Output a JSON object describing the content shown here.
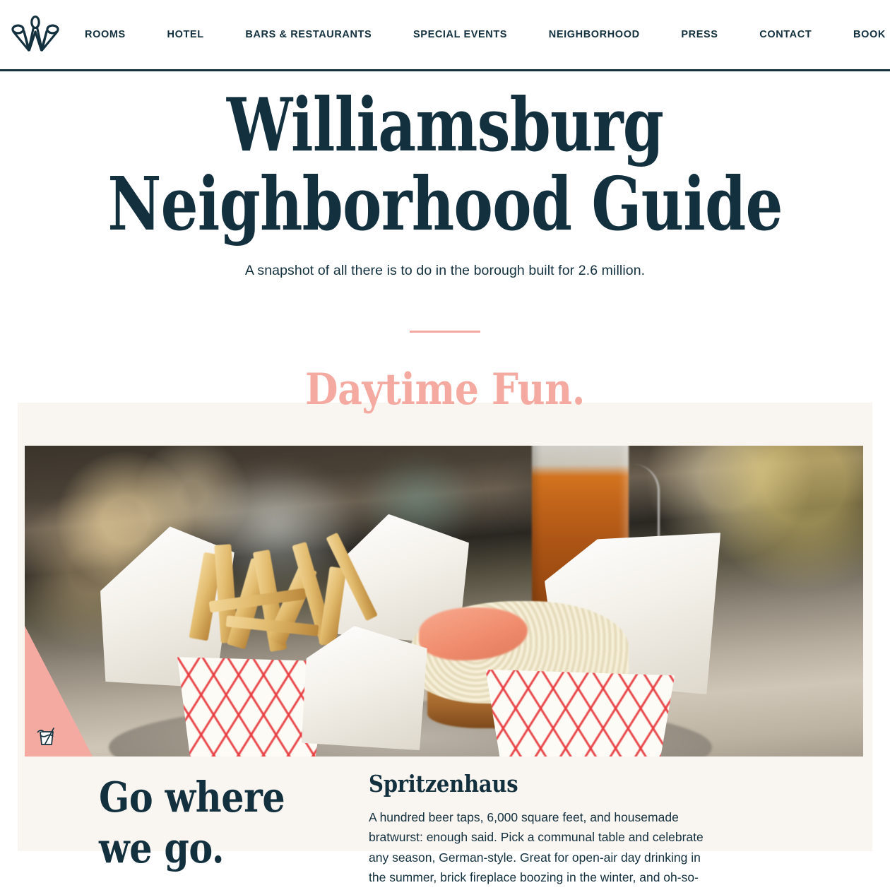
{
  "header": {
    "logo_name": "williamsburg-hotel-crown-monogram",
    "nav": [
      {
        "label": "ROOMS"
      },
      {
        "label": "HOTEL"
      },
      {
        "label": "BARS & RESTAURANTS"
      },
      {
        "label": "SPECIAL EVENTS"
      },
      {
        "label": "NEIGHBORHOOD"
      },
      {
        "label": "PRESS"
      },
      {
        "label": "CONTACT"
      },
      {
        "label": "BOOK"
      }
    ]
  },
  "hero": {
    "title_line1": "Williamsburg",
    "title_line2": "Neighborhood Guide",
    "subtitle": "A snapshot of all there is to do in the borough built for 2.6 million."
  },
  "section": {
    "title": "Daytime Fun."
  },
  "feature": {
    "photo_alt": "Basket of french fries and a sauerkraut-topped sandwich with a beer on a bar counter",
    "badge_icon": "cocktail-glass-icon",
    "lead_title": "Go where we go.",
    "venue_name": "Spritzenhaus",
    "venue_body": "A hundred beer taps, 6,000 square feet, and housemade bratwurst: enough said. Pick a communal table and celebrate any season, German-style. Great for open-air day drinking in the summer, brick fireplace boozing in the winter, and oh-so-"
  },
  "colors": {
    "navy": "#13303e",
    "pink": "#f5aaa1",
    "cream": "#f9f5f1",
    "white": "#ffffff"
  }
}
